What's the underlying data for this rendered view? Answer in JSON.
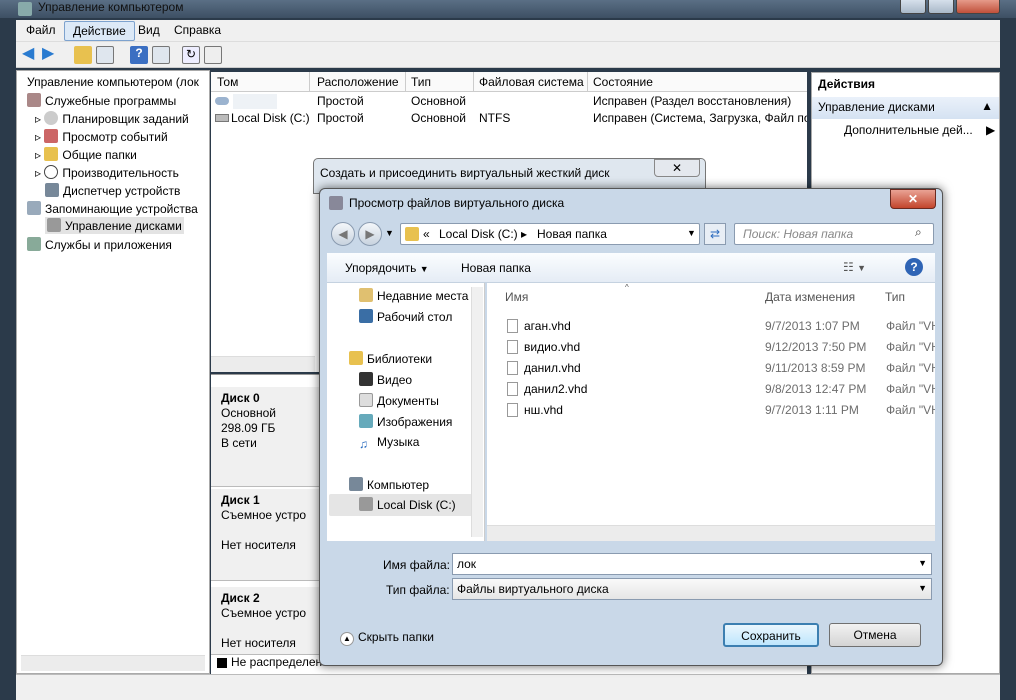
{
  "window": {
    "title": "Управление компьютером"
  },
  "menu": [
    "Файл",
    "Действие",
    "Вид",
    "Справка"
  ],
  "tree": [
    "Управление компьютером (лок",
    "Служебные программы",
    "Планировщик заданий",
    "Просмотр событий",
    "Общие папки",
    "Производительность",
    "Диспетчер устройств",
    "Запоминающие устройства",
    "Управление дисками",
    "Службы и приложения"
  ],
  "columns": [
    "Том",
    "Расположение",
    "Тип",
    "Файловая система",
    "Состояние"
  ],
  "volumes": [
    {
      "name": "",
      "location": "Простой",
      "type": "Основной",
      "fs": "",
      "status": "Исправен (Раздел восстановления)"
    },
    {
      "name": "Local Disk (C:)",
      "location": "Простой",
      "type": "Основной",
      "fs": "NTFS",
      "status": "Исправен (Система, Загрузка, Файл по"
    }
  ],
  "disks": [
    {
      "name": "Диск 0",
      "type": "Основной",
      "size": "298.09 ГБ",
      "state": "В сети"
    },
    {
      "name": "Диск 1",
      "type": "Съемное устро",
      "state": "Нет носителя"
    },
    {
      "name": "Диск 2",
      "type": "Съемное устро",
      "state": "Нет носителя"
    }
  ],
  "legend": "Не распределен",
  "actions": {
    "header": "Действия",
    "section": "Управление дисками",
    "more": "Дополнительные дей..."
  },
  "dialog1": {
    "title": "Создать и присоединить виртуальный жесткий диск"
  },
  "dialog2": {
    "title": "Просмотр файлов виртуального диска",
    "breadcrumb": [
      "Local Disk (C:)",
      "Новая папка"
    ],
    "search_placeholder": "Поиск: Новая папка",
    "organize": "Упорядочить",
    "new_folder": "Новая папка",
    "nav": [
      "Недавние места",
      "Рабочий стол",
      "Библиотеки",
      "Видео",
      "Документы",
      "Изображения",
      "Музыка",
      "Компьютер",
      "Local Disk (C:)"
    ],
    "file_columns": [
      "Имя",
      "Дата изменения",
      "Тип"
    ],
    "files": [
      {
        "name": "аган.vhd",
        "date": "9/7/2013 1:07 PM",
        "type": "Файл \"VH"
      },
      {
        "name": "видио.vhd",
        "date": "9/12/2013 7:50 PM",
        "type": "Файл \"VH"
      },
      {
        "name": "данил.vhd",
        "date": "9/11/2013 8:59 PM",
        "type": "Файл \"VH"
      },
      {
        "name": "данил2.vhd",
        "date": "9/8/2013 12:47 PM",
        "type": "Файл \"VH"
      },
      {
        "name": "нш.vhd",
        "date": "9/7/2013 1:11 PM",
        "type": "Файл \"VH"
      }
    ],
    "filename_label": "Имя файла:",
    "filename_value": "лок",
    "filetype_label": "Тип файла:",
    "filetype_value": "Файлы виртуального диска",
    "hide_folders": "Скрыть папки",
    "save": "Сохранить",
    "cancel": "Отмена"
  }
}
